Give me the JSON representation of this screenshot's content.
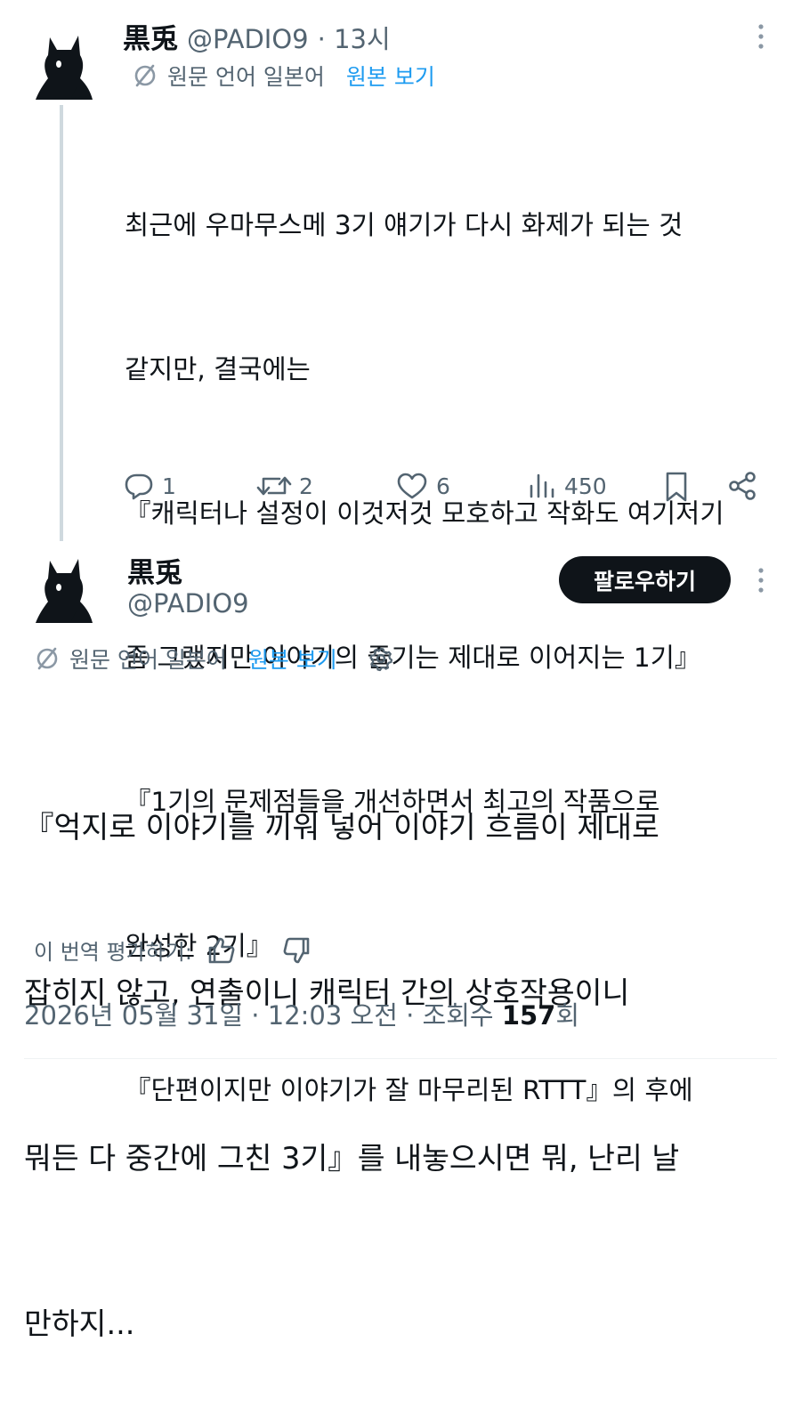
{
  "tweet1": {
    "author_name": "黒兎",
    "author_handle": "@PADIO9",
    "time": "· 13시",
    "translation_label": "원문 언어 일본어",
    "show_original": "원본 보기",
    "lines": [
      "최근에 우마무스메 3기 얘기가 다시 화제가 되는 것",
      "같지만, 결국에는",
      "『캐릭터나 설정이 이것저것 모호하고 작화도 여기저기",
      "좀 그랬지만 이야기의 줄기는 제대로 이어지는 1기』",
      "『1기의 문제점들을 개선하면서 최고의 작품으로",
      "완성한 2기』",
      "『단편이지만 이야기가 잘 마무리된 RTTT』의 후에"
    ],
    "replies": "1",
    "reposts": "2",
    "likes": "6",
    "views": "450"
  },
  "tweet2": {
    "author_name": "黒兎",
    "author_handle": "@PADIO9",
    "follow_label": "팔로우하기",
    "translation_label": "원문 언어 일본어",
    "show_original": "원본 보기",
    "lines": [
      "『억지로 이야기를 끼워 넣어 이야기 흐름이 제대로",
      "잡히지 않고, 연출이니 캐릭터 간의 상호작용이니",
      "뭐든 다 중간에 그친 3기』를 내놓으시면 뭐, 난리 날",
      "만하지..."
    ],
    "rate_label": "이 번역 평가하기:",
    "meta_prefix": "2026년 05월 31일 · 12:03 오전 · 조회수 ",
    "view_count": "157",
    "view_suffix": "회"
  },
  "icons": [
    "avatar-cat-silhouette",
    "translate-icon",
    "more-icon",
    "reply-icon",
    "repost-icon",
    "like-icon",
    "views-icon",
    "bookmark-icon",
    "share-icon",
    "gear-icon",
    "thumbs-up-icon",
    "thumbs-down-icon"
  ],
  "colors": {
    "accent": "#1d9bf0",
    "text": "#0f1419",
    "secondary": "#536471",
    "follow_button": "#0f1419"
  }
}
